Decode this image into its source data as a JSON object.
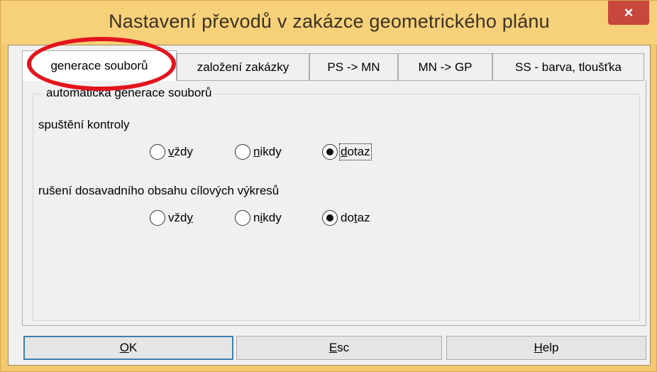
{
  "window": {
    "title": "Nastavení převodů v zakázce geometrického plánu",
    "close_label": "×"
  },
  "tabs": [
    {
      "label": "generace souborů",
      "active": true
    },
    {
      "label": "založení zakázky",
      "active": false
    },
    {
      "label": "PS -> MN",
      "active": false
    },
    {
      "label": "MN -> GP",
      "active": false
    },
    {
      "label": "SS - barva, tloušťka",
      "active": false
    }
  ],
  "group": {
    "legend": "automatická generace souborů"
  },
  "section1": {
    "label": "spuštění kontroly",
    "options": [
      {
        "pre": "",
        "key": "v",
        "post": "ždy",
        "checked": false
      },
      {
        "pre": "",
        "key": "n",
        "post": "ikdy",
        "checked": false
      },
      {
        "pre": "",
        "key": "d",
        "post": "otaz",
        "checked": true
      }
    ]
  },
  "section2": {
    "label": "rušení dosavadního obsahu cílových výkresů",
    "options": [
      {
        "pre": "vžd",
        "key": "y",
        "post": "",
        "checked": false
      },
      {
        "pre": "n",
        "key": "i",
        "post": "kdy",
        "checked": false
      },
      {
        "pre": "do",
        "key": "t",
        "post": "az",
        "checked": true
      }
    ]
  },
  "buttons": {
    "ok": {
      "key": "O",
      "rest": "K"
    },
    "esc": {
      "key": "E",
      "rest": "sc"
    },
    "help": {
      "key": "H",
      "rest": "elp"
    }
  },
  "colors": {
    "highlight": "#e3141c",
    "titlebar": "#f7d07a",
    "close": "#c8463b"
  }
}
